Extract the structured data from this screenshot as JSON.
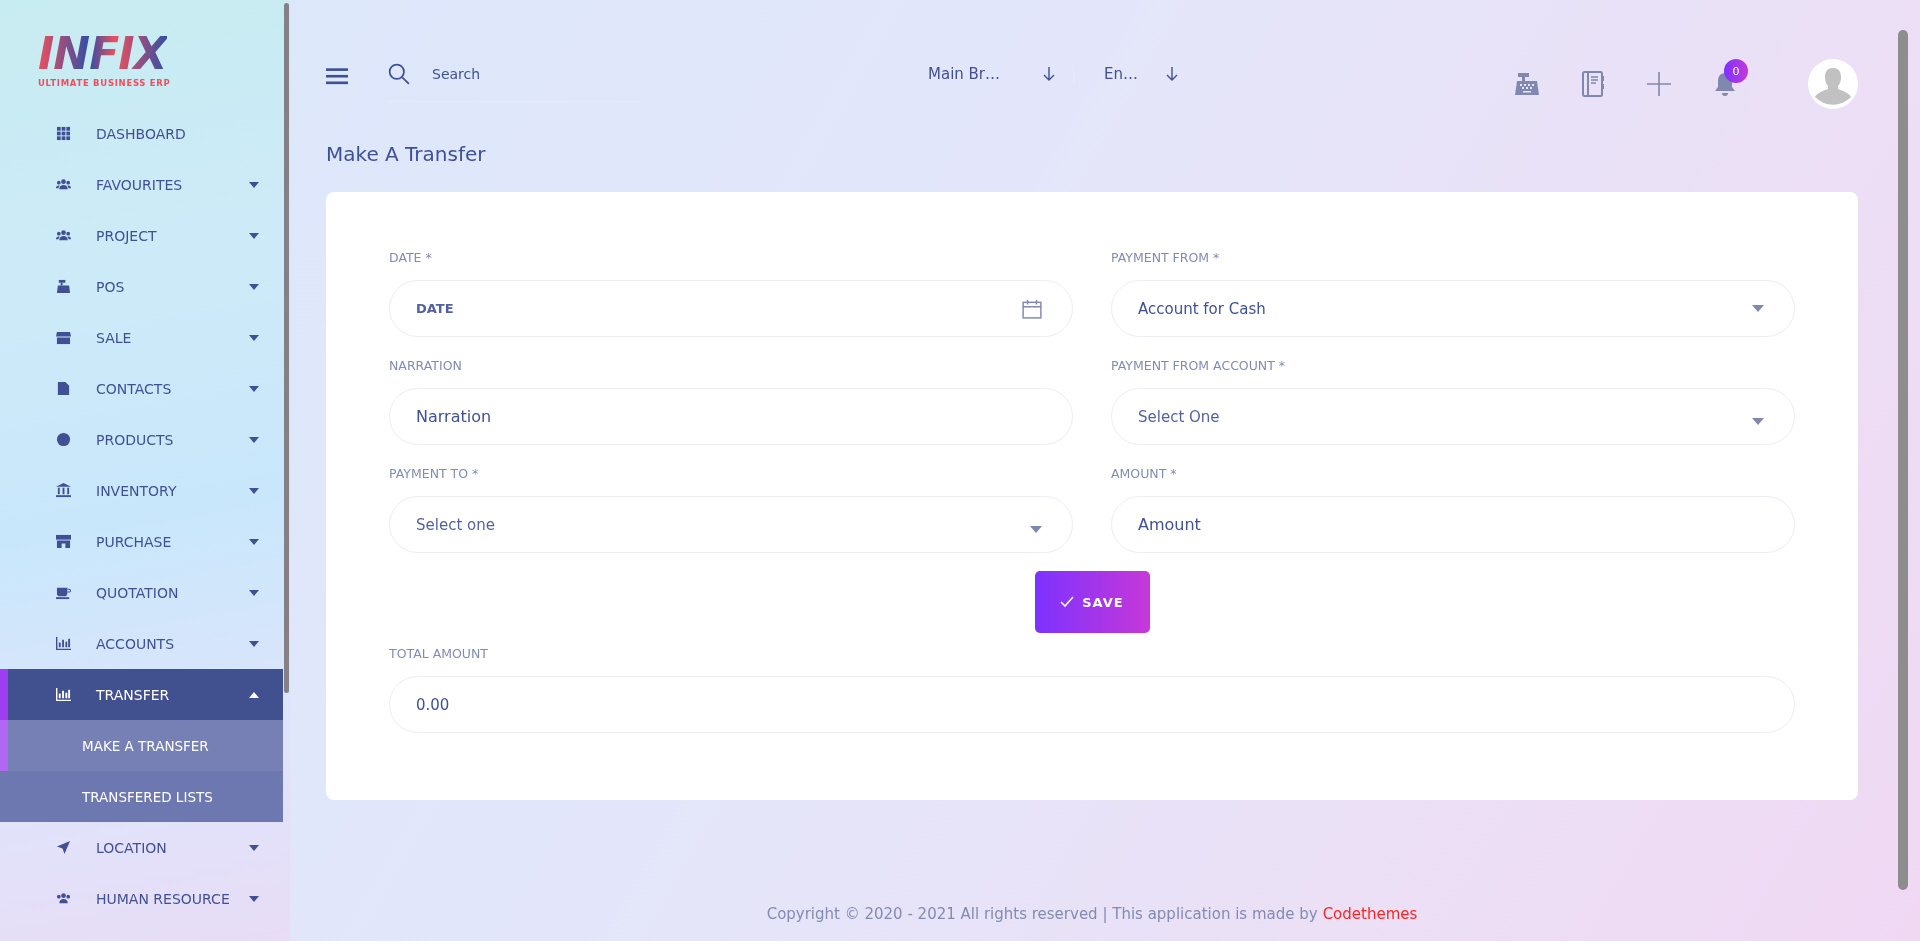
{
  "logo": {
    "name": "INFIX",
    "tagline": "ULTIMATE BUSINESS ERP"
  },
  "sidebar": {
    "items": [
      {
        "label": "DASHBOARD",
        "selected": false
      },
      {
        "label": "FAVOURITES",
        "selected": false,
        "expanded": false
      },
      {
        "label": "PROJECT",
        "selected": false,
        "expanded": false
      },
      {
        "label": "POS",
        "selected": false,
        "expanded": false
      },
      {
        "label": "SALE",
        "selected": false,
        "expanded": false
      },
      {
        "label": "CONTACTS",
        "selected": false,
        "expanded": false
      },
      {
        "label": "PRODUCTS",
        "selected": false,
        "expanded": false
      },
      {
        "label": "INVENTORY",
        "selected": false,
        "expanded": false
      },
      {
        "label": "PURCHASE",
        "selected": false,
        "expanded": false
      },
      {
        "label": "QUOTATION",
        "selected": false,
        "expanded": false
      },
      {
        "label": "ACCOUNTS",
        "selected": false,
        "expanded": false
      },
      {
        "label": "TRANSFER",
        "selected": true,
        "expanded": true,
        "children": [
          {
            "label": "MAKE A TRANSFER",
            "selected": true
          },
          {
            "label": "TRANSFERED LISTS",
            "selected": false
          }
        ]
      },
      {
        "label": "LOCATION",
        "selected": false,
        "expanded": false
      },
      {
        "label": "HUMAN RESOURCE",
        "selected": false,
        "expanded": false
      }
    ]
  },
  "header": {
    "search": {
      "placeholder": "Search"
    },
    "selectors": [
      {
        "value": "Main Br…"
      },
      {
        "value": "En…"
      }
    ],
    "notifications": {
      "count": "0"
    }
  },
  "page_title": "Make A Transfer",
  "form": {
    "fields": [
      {
        "kind": "date",
        "label": "DATE *",
        "placeholder": "DATE"
      },
      {
        "kind": "select",
        "label": "PAYMENT FROM *",
        "value": "Account for Cash"
      },
      {
        "kind": "text",
        "label": "NARRATION",
        "placeholder": "Narration"
      },
      {
        "kind": "select",
        "label": "PAYMENT FROM ACCOUNT *",
        "placeholder": "Select One"
      },
      {
        "kind": "select",
        "label": "PAYMENT TO *",
        "placeholder": "Select one"
      },
      {
        "kind": "text",
        "label": "AMOUNT *",
        "placeholder": "Amount"
      }
    ],
    "save_button": "SAVE",
    "total": {
      "label": "TOTAL AMOUNT",
      "value": "0.00"
    }
  },
  "footer": {
    "text": "Copyright © 2020 - 2021 All rights reserved | This application is made by",
    "link": "Codethemes"
  }
}
